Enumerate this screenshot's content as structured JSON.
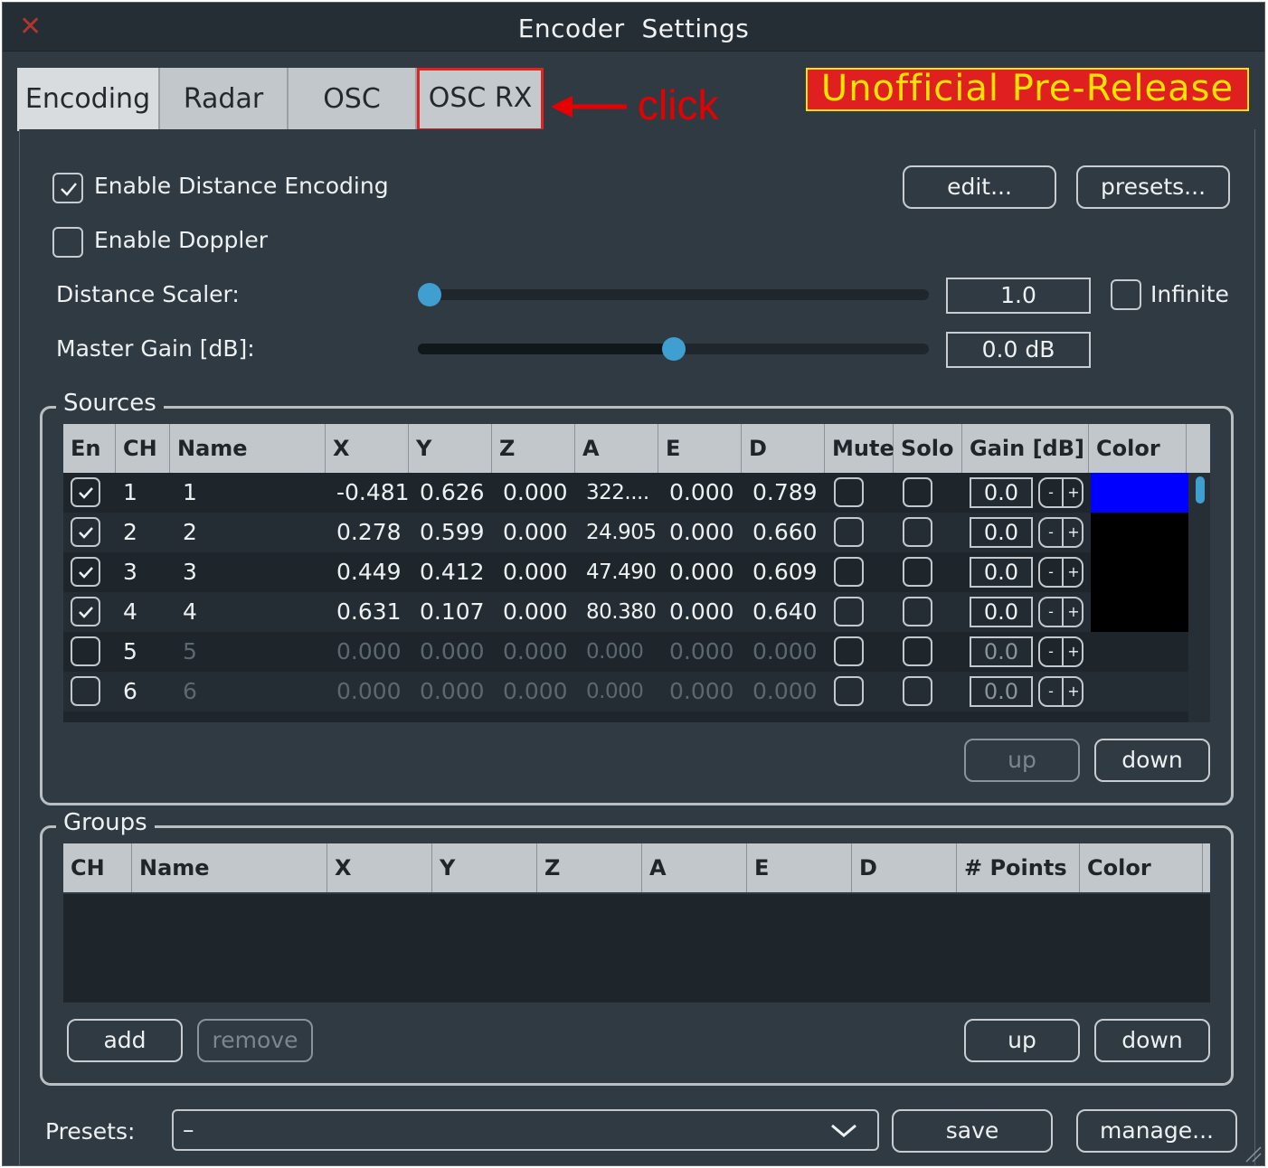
{
  "window": {
    "title": "Encoder  Settings"
  },
  "tabs": [
    {
      "label": "Encoding"
    },
    {
      "label": "Radar"
    },
    {
      "label": "OSC"
    },
    {
      "label": "OSC RX"
    }
  ],
  "annotation": {
    "click_label": "click",
    "banner": "Unofficial Pre-Release"
  },
  "encoding": {
    "enable_distance": {
      "label": "Enable Distance Encoding",
      "checked": true
    },
    "enable_doppler": {
      "label": "Enable Doppler",
      "checked": false
    },
    "edit_label": "edit...",
    "presets_label": "presets...",
    "distance_scaler": {
      "label": "Distance Scaler:",
      "value": "1.0",
      "slider_fraction": 0.0
    },
    "infinite": {
      "label": "Infinite",
      "checked": false
    },
    "master_gain": {
      "label": "Master Gain [dB]:",
      "value": "0.0 dB",
      "slider_fraction": 0.5
    }
  },
  "sources": {
    "title": "Sources",
    "columns": [
      "En",
      "CH",
      "Name",
      "X",
      "Y",
      "Z",
      "A",
      "E",
      "D",
      "Mute",
      "Solo",
      "Gain [dB]",
      "Color"
    ],
    "rows": [
      {
        "en": true,
        "ch": "1",
        "name": "1",
        "x": "-0.481",
        "y": "0.626",
        "z": "0.000",
        "a": "322....",
        "e": "0.000",
        "d": "0.789",
        "gain": "0.0",
        "color": "#0000ff",
        "active": true
      },
      {
        "en": true,
        "ch": "2",
        "name": "2",
        "x": "0.278",
        "y": "0.599",
        "z": "0.000",
        "a": "24.905",
        "e": "0.000",
        "d": "0.660",
        "gain": "0.0",
        "color": "#000000",
        "active": true
      },
      {
        "en": true,
        "ch": "3",
        "name": "3",
        "x": "0.449",
        "y": "0.412",
        "z": "0.000",
        "a": "47.490",
        "e": "0.000",
        "d": "0.609",
        "gain": "0.0",
        "color": "#000000",
        "active": true
      },
      {
        "en": true,
        "ch": "4",
        "name": "4",
        "x": "0.631",
        "y": "0.107",
        "z": "0.000",
        "a": "80.380",
        "e": "0.000",
        "d": "0.640",
        "gain": "0.0",
        "color": "#000000",
        "active": true
      },
      {
        "en": false,
        "ch": "5",
        "name": "5",
        "x": "0.000",
        "y": "0.000",
        "z": "0.000",
        "a": "0.000",
        "e": "0.000",
        "d": "0.000",
        "gain": "0.0",
        "color": "",
        "active": false
      },
      {
        "en": false,
        "ch": "6",
        "name": "6",
        "x": "0.000",
        "y": "0.000",
        "z": "0.000",
        "a": "0.000",
        "e": "0.000",
        "d": "0.000",
        "gain": "0.0",
        "color": "",
        "active": false
      }
    ],
    "gain_minus": "-",
    "gain_plus": "+",
    "up_label": "up",
    "down_label": "down"
  },
  "groups": {
    "title": "Groups",
    "columns": [
      "CH",
      "Name",
      "X",
      "Y",
      "Z",
      "A",
      "E",
      "D",
      "# Points",
      "Color"
    ],
    "add_label": "add",
    "remove_label": "remove",
    "up_label": "up",
    "down_label": "down"
  },
  "presets": {
    "label": "Presets:",
    "selected": "–",
    "save_label": "save",
    "manage_label": "manage..."
  }
}
